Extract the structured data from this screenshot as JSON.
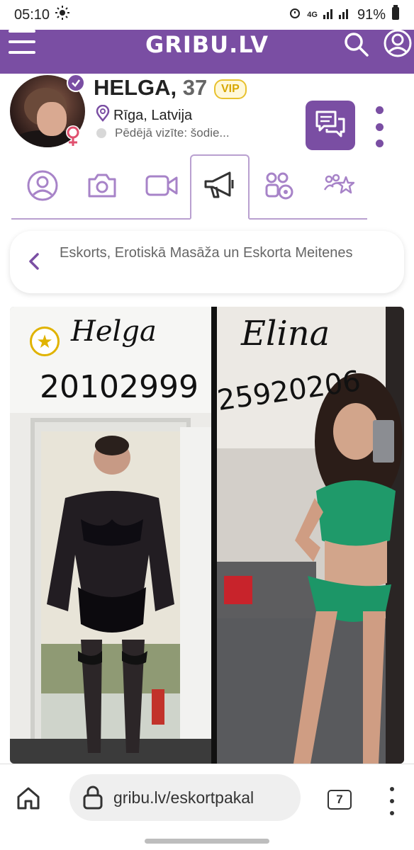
{
  "status_bar": {
    "time": "05:10",
    "network": "4G",
    "battery": "91%"
  },
  "header": {
    "logo": "GRIBU.LV",
    "menu_icon": "hamburger-icon",
    "search_icon": "search-icon",
    "account_icon": "user-icon",
    "brand_color": "#7a4ea3"
  },
  "profile": {
    "name": "HELGA,",
    "age": "37",
    "badge": "VIP",
    "location": "Rīga, Latvija",
    "last_visit": "Pēdējā vizīte: šodie..."
  },
  "tabs": [
    {
      "icon": "profile-icon",
      "active": false
    },
    {
      "icon": "camera-icon",
      "active": false
    },
    {
      "icon": "video-icon",
      "active": false
    },
    {
      "icon": "megaphone-icon",
      "active": true
    },
    {
      "icon": "group-video-icon",
      "active": false
    },
    {
      "icon": "friends-star-icon",
      "active": false
    }
  ],
  "breadcrumb": {
    "text": "Eskorts, Erotiskā Masāža un Eskorta Meitenes"
  },
  "photo": {
    "left_name": "Helga",
    "left_phone": "20102999",
    "right_name": "Elina",
    "right_phone": "25920206"
  },
  "browser": {
    "url": "gribu.lv/eskortpakal",
    "tab_count": "7"
  }
}
